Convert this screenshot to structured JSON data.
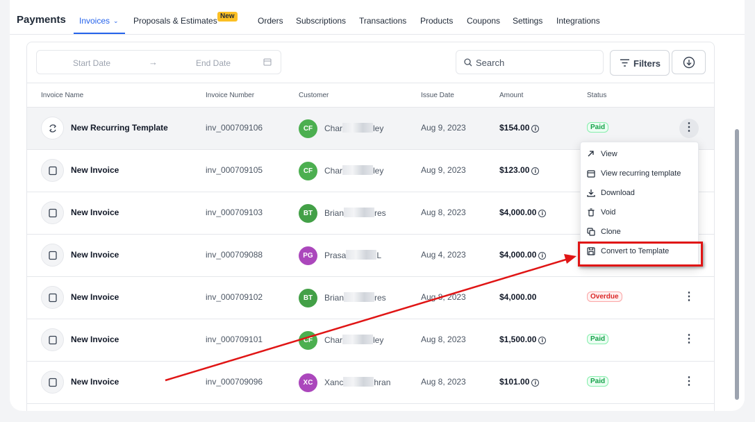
{
  "nav": {
    "brand": "Payments",
    "items": [
      {
        "label": "Invoices"
      },
      {
        "label": "Proposals & Estimates"
      },
      {
        "label": "Orders"
      },
      {
        "label": "Subscriptions"
      },
      {
        "label": "Transactions"
      },
      {
        "label": "Products"
      },
      {
        "label": "Coupons"
      },
      {
        "label": "Settings"
      },
      {
        "label": "Integrations"
      }
    ],
    "new_badge": "New"
  },
  "toolbar": {
    "start_date": "Start Date",
    "end_date": "End Date",
    "search": "Search",
    "filters": "Filters"
  },
  "table": {
    "headers": [
      "Invoice Name",
      "Invoice Number",
      "Customer",
      "Issue Date",
      "Amount",
      "Status"
    ],
    "rows": [
      {
        "name": "New Recurring Template",
        "number": "inv_000709106",
        "initials": "CF",
        "cust_a": "Char",
        "cust_b": "ley",
        "date": "Aug 9, 2023",
        "amount": "$154.00",
        "status": "Paid"
      },
      {
        "name": "New Invoice",
        "number": "inv_000709105",
        "initials": "CF",
        "cust_a": "Char",
        "cust_b": "ley",
        "date": "Aug 9, 2023",
        "amount": "$123.00",
        "status": ""
      },
      {
        "name": "New Invoice",
        "number": "inv_000709103",
        "initials": "BT",
        "cust_a": "Brian",
        "cust_b": "res",
        "date": "Aug 8, 2023",
        "amount": "$4,000.00",
        "status": ""
      },
      {
        "name": "New Invoice",
        "number": "inv_000709088",
        "initials": "PG",
        "cust_a": "Prasa",
        "cust_b": "L",
        "date": "Aug 4, 2023",
        "amount": "$4,000.00",
        "status": ""
      },
      {
        "name": "New Invoice",
        "number": "inv_000709102",
        "initials": "BT",
        "cust_a": "Brian",
        "cust_b": "res",
        "date": "Aug 8, 2023",
        "amount": "$4,000.00",
        "status": "Overdue"
      },
      {
        "name": "New Invoice",
        "number": "inv_000709101",
        "initials": "CF",
        "cust_a": "Char",
        "cust_b": "ley",
        "date": "Aug 8, 2023",
        "amount": "$1,500.00",
        "status": "Paid"
      },
      {
        "name": "New Invoice",
        "number": "inv_000709096",
        "initials": "XC",
        "cust_a": "Xanc",
        "cust_b": "hran",
        "date": "Aug 8, 2023",
        "amount": "$101.00",
        "status": "Paid"
      }
    ]
  },
  "menu": {
    "items": [
      "View",
      "View recurring template",
      "Download",
      "Void",
      "Clone",
      "Convert to Template"
    ]
  },
  "colors": {
    "accent": "#2563eb",
    "paid": "#16a34a",
    "overdue": "#dc2626",
    "annotation": "#e01515",
    "avatar_cf": "#4caf50",
    "avatar_bt": "#43a047",
    "avatar_pg": "#ab47bc",
    "avatar_xc": "#ab47bc"
  }
}
